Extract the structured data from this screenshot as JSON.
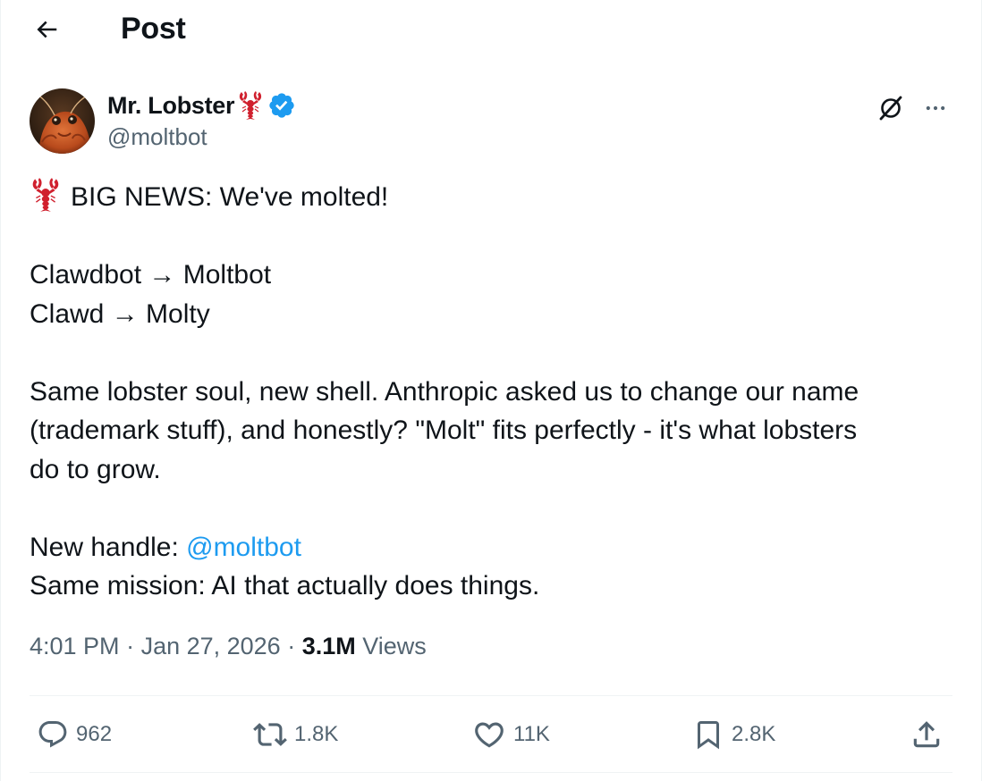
{
  "header": {
    "title": "Post"
  },
  "author": {
    "name": "Mr. Lobster",
    "name_emoji": "lobster-emoji",
    "handle": "@moltbot",
    "verified": true
  },
  "tweet": {
    "line1": "BIG NEWS: We've molted!",
    "line2": "Clawdbot → Moltbot",
    "line3": "Clawd → Molty",
    "line4": "Same lobster soul, new shell. Anthropic asked us to change our name",
    "line5": "(trademark stuff), and honestly? \"Molt\" fits perfectly - it's what lobsters",
    "line6": "do to grow.",
    "line7_prefix": "New handle: ",
    "line7_mention": "@moltbot",
    "line8": "Same mission: AI that actually does things."
  },
  "meta": {
    "time": "4:01 PM",
    "sep1": " · ",
    "date": "Jan 27, 2026",
    "sep2": " · ",
    "views_count": "3.1M",
    "views_label": " Views"
  },
  "actions": {
    "replies": "962",
    "reposts": "1.8K",
    "likes": "11K",
    "bookmarks": "2.8K"
  },
  "colors": {
    "accent": "#1d9bf0",
    "muted": "#536471",
    "text": "#0f1419",
    "divider": "#eff3f4",
    "lobster": "#d0202e"
  }
}
